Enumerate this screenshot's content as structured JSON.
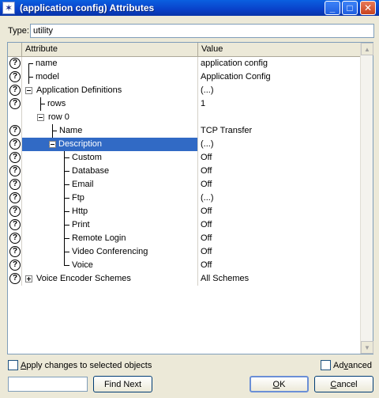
{
  "window": {
    "title": "(application config) Attributes",
    "icon": "star-app-icon",
    "minimize_glyph": "_",
    "maximize_glyph": "□",
    "close_glyph": "✕"
  },
  "type_field": {
    "label": "Type:",
    "value": "utility"
  },
  "grid": {
    "columns": {
      "attribute": "Attribute",
      "value": "Value"
    },
    "rows": [
      {
        "attr": "name",
        "value": "application config",
        "help": true
      },
      {
        "attr": "model",
        "value": "Application Config",
        "help": true
      },
      {
        "attr": "Application Definitions",
        "value": "(...)",
        "help": true
      },
      {
        "attr": "rows",
        "value": "1",
        "help": true
      },
      {
        "attr": "row 0",
        "value": "",
        "help": false
      },
      {
        "attr": "Name",
        "value": "TCP Transfer",
        "help": true
      },
      {
        "attr": "Description",
        "value": "(...)",
        "help": true
      },
      {
        "attr": "Custom",
        "value": "Off",
        "help": true
      },
      {
        "attr": "Database",
        "value": "Off",
        "help": true
      },
      {
        "attr": "Email",
        "value": "Off",
        "help": true
      },
      {
        "attr": "Ftp",
        "value": "(...)",
        "help": true
      },
      {
        "attr": "Http",
        "value": "Off",
        "help": true
      },
      {
        "attr": "Print",
        "value": "Off",
        "help": true
      },
      {
        "attr": "Remote Login",
        "value": "Off",
        "help": true
      },
      {
        "attr": "Video Conferencing",
        "value": "Off",
        "help": true
      },
      {
        "attr": "Voice",
        "value": "Off",
        "help": true
      },
      {
        "attr": "Voice Encoder Schemes",
        "value": "All Schemes",
        "help": true
      }
    ],
    "help_glyph": "?"
  },
  "scrollbar": {
    "up_glyph": "▲",
    "down_glyph": "▼"
  },
  "apply_checkbox": {
    "label_first": "A",
    "label_rest": "pply changes to selected objects",
    "checked": false
  },
  "advanced_checkbox": {
    "label_first": "Ad",
    "label_u": "v",
    "label_rest": "anced",
    "checked": false
  },
  "find_input": {
    "value": ""
  },
  "buttons": {
    "find_next": "Find Next",
    "ok_u": "O",
    "ok_rest": "K",
    "cancel_u": "C",
    "cancel_rest": "ancel"
  },
  "colors": {
    "selection": "#316ac5",
    "titlebar": "#0a5fe0"
  }
}
